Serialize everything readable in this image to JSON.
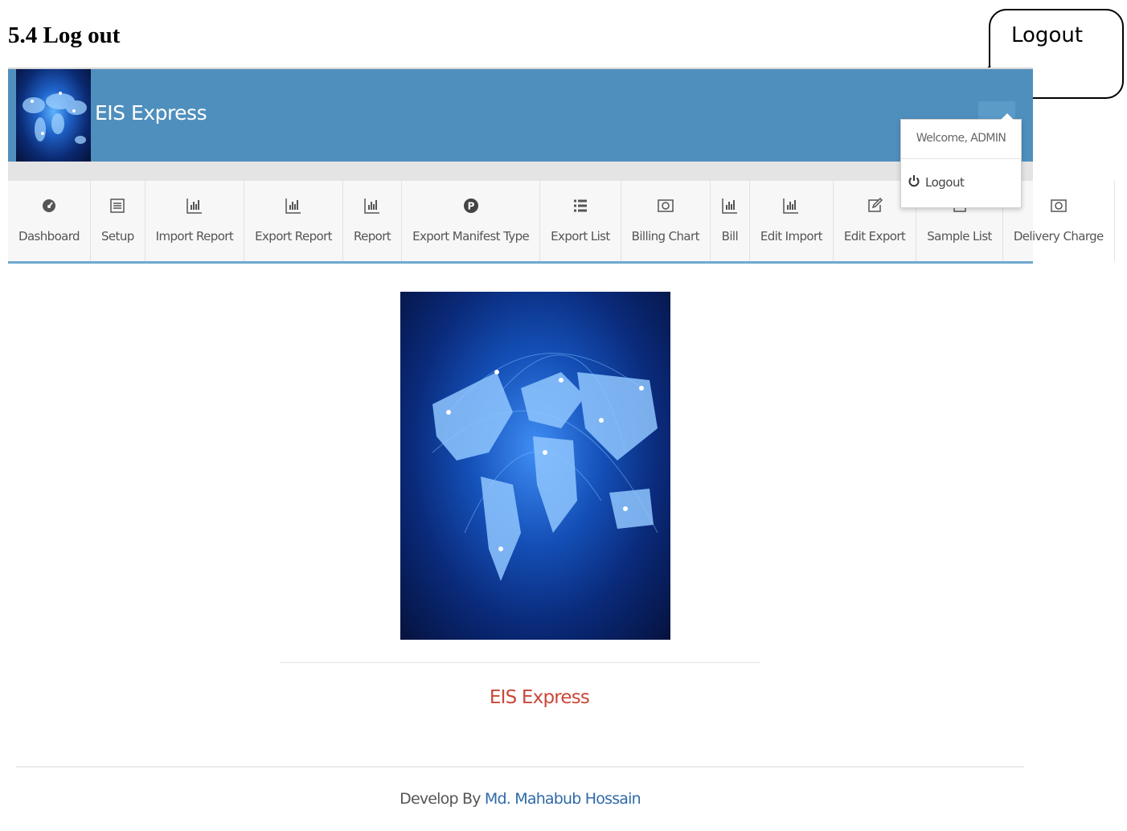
{
  "document": {
    "heading": "5.4 Log out"
  },
  "callout": {
    "text": "Logout"
  },
  "app": {
    "title": "EIS Express"
  },
  "nav": {
    "items": [
      {
        "label": "Dashboard",
        "icon": "dashboard-icon"
      },
      {
        "label": "Setup",
        "icon": "list-icon"
      },
      {
        "label": "Import Report",
        "icon": "bar-chart-icon"
      },
      {
        "label": "Export Report",
        "icon": "bar-chart-icon"
      },
      {
        "label": "Report",
        "icon": "bar-chart-icon"
      },
      {
        "label": "Export Manifest Type",
        "icon": "p-badge-icon"
      },
      {
        "label": "Export List",
        "icon": "list-icon"
      },
      {
        "label": "Billing Chart",
        "icon": "money-icon"
      },
      {
        "label": "Bill",
        "icon": "bar-chart-icon"
      },
      {
        "label": "Edit Import",
        "icon": "bar-chart-icon"
      },
      {
        "label": "Edit Export",
        "icon": "edit-icon"
      },
      {
        "label": "Sample List",
        "icon": "edit-icon"
      },
      {
        "label": "Delivery Charge",
        "icon": "money-icon"
      }
    ]
  },
  "user_menu": {
    "welcome": "Welcome, ADMIN",
    "logout_label": "Logout"
  },
  "main": {
    "brand": "EIS Express"
  },
  "footer": {
    "prefix": "Develop By",
    "author": "Md. Mahabub Hossain"
  },
  "colors": {
    "header": "#4f8fbd",
    "nav_bg": "#f7f7f7",
    "brand_red": "#c9473a",
    "author_blue": "#2f6aa8"
  }
}
